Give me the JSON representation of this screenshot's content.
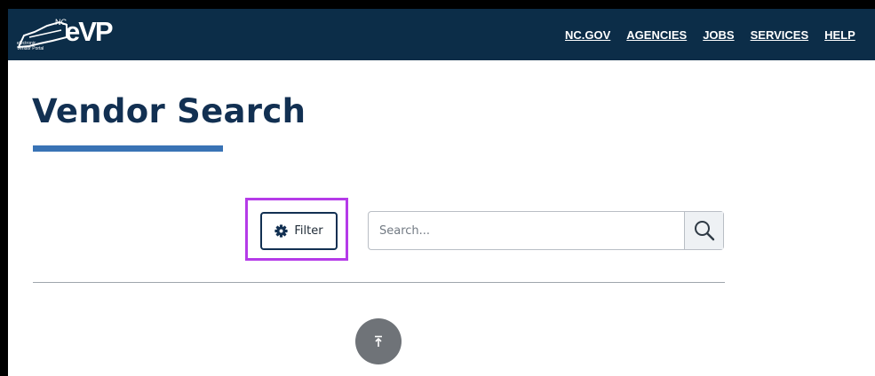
{
  "header": {
    "logo": {
      "nc_text": "NC",
      "brand_text": "eVP",
      "tagline": "electronic Vendor Portal"
    },
    "nav": [
      "NC.GOV",
      "AGENCIES",
      "JOBS",
      "SERVICES",
      "HELP"
    ]
  },
  "page": {
    "title": "Vendor Search"
  },
  "toolbar": {
    "filter_label": "Filter",
    "search_placeholder": "Search...",
    "search_value": ""
  },
  "colors": {
    "header_bg": "#0c2d48",
    "title": "#123052",
    "accent_bar": "#3973b5",
    "highlight_outline": "#b53be8",
    "back_to_top": "#6f7378"
  },
  "icons": {
    "filter": "gear-icon",
    "search": "magnifier-icon",
    "back_to_top": "arrow-up-to-line-icon"
  }
}
